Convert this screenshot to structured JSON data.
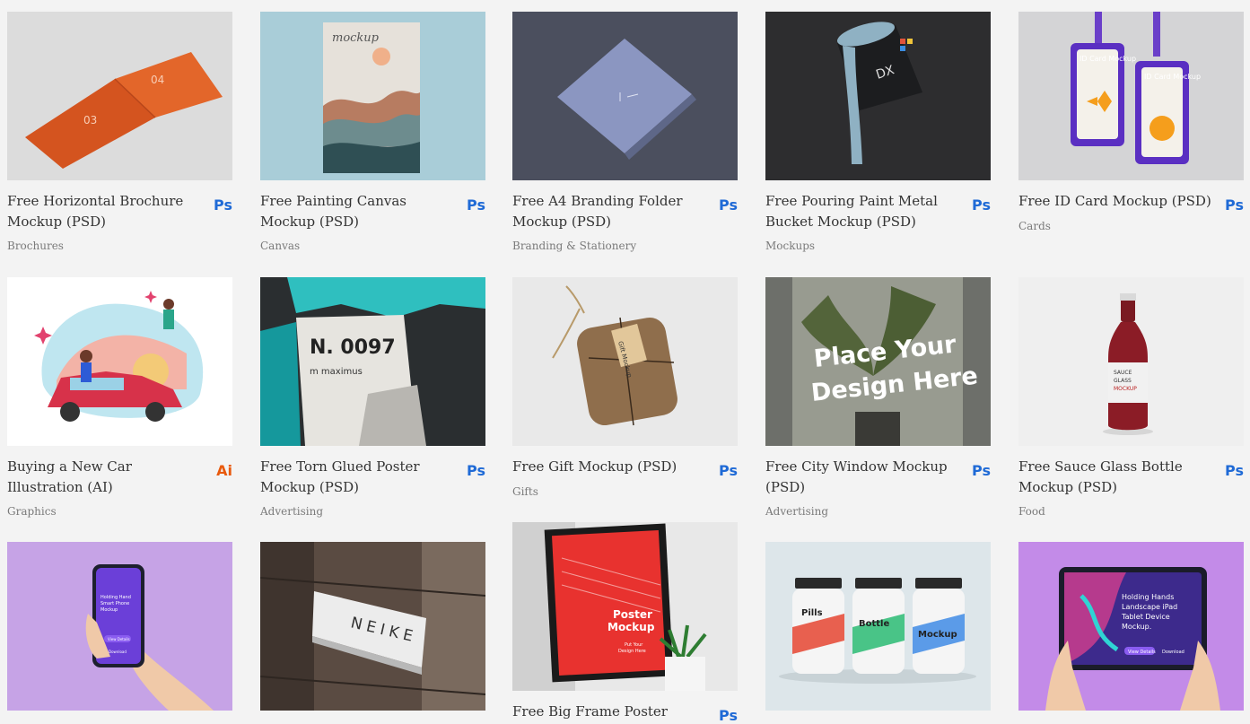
{
  "colors": {
    "background": "#f3f3f3",
    "ps_badge": "#1f6ad6",
    "ai_badge": "#e8590c"
  },
  "cards": [
    {
      "title": "Free Horizontal Brochure Mockup (PSD)",
      "badge": "Ps",
      "category": "Brochures",
      "thumb_text": [
        "03",
        "04"
      ]
    },
    {
      "title": "Free Painting Canvas Mockup (PSD)",
      "badge": "Ps",
      "category": "Canvas",
      "thumb_text": [
        "mockup"
      ]
    },
    {
      "title": "Free A4 Branding Folder Mockup (PSD)",
      "badge": "Ps",
      "category": "Branding & Stationery",
      "thumb_text": []
    },
    {
      "title": "Free Pouring Paint Metal Bucket Mockup (PSD)",
      "badge": "Ps",
      "category": "Mockups",
      "thumb_text": [
        "DX"
      ]
    },
    {
      "title": "Free ID Card Mockup (PSD)",
      "badge": "Ps",
      "category": "Cards",
      "thumb_text": [
        "ID Card Mockup",
        "ID Card Mockup"
      ]
    },
    {
      "title": "Buying a New Car Illustration (AI)",
      "badge": "Ai",
      "category": "Graphics",
      "thumb_text": []
    },
    {
      "title": "Free Torn Glued Poster Mockup (PSD)",
      "badge": "Ps",
      "category": "Advertising",
      "thumb_text": [
        "N. 0097",
        "m maximus"
      ]
    },
    {
      "title": "Free Gift Mockup (PSD)",
      "badge": "Ps",
      "category": "Gifts",
      "thumb_text": [
        "Gift Mockup"
      ]
    },
    {
      "title": "Free City Window Mockup (PSD)",
      "badge": "Ps",
      "category": "Advertising",
      "thumb_text": [
        "Place Your",
        "Design Here"
      ]
    },
    {
      "title": "Free Sauce Glass Bottle Mockup (PSD)",
      "badge": "Ps",
      "category": "Food",
      "thumb_text": [
        "SAUCE",
        "GLASS",
        "MOCKUP"
      ]
    },
    {
      "title": "",
      "badge": "",
      "category": "",
      "thumb_text": [
        "Holding Hand",
        "Smart Phone",
        "Mockup",
        "View Details",
        "Download"
      ]
    },
    {
      "title": "",
      "badge": "",
      "category": "",
      "thumb_text": [
        "NEIKE"
      ]
    },
    {
      "title": "Free Big Frame Poster",
      "badge": "Ps",
      "category": "",
      "thumb_text": [
        "Poster",
        "Mockup",
        "Put Your",
        "Design Here"
      ]
    },
    {
      "title": "",
      "badge": "",
      "category": "",
      "thumb_text": [
        "Pills",
        "Bottle",
        "Mockup"
      ]
    },
    {
      "title": "",
      "badge": "",
      "category": "",
      "thumb_text": [
        "Holding Hands",
        "Landscape iPad",
        "Tablet Device",
        "Mockup.",
        "View Details",
        "Download"
      ]
    }
  ]
}
